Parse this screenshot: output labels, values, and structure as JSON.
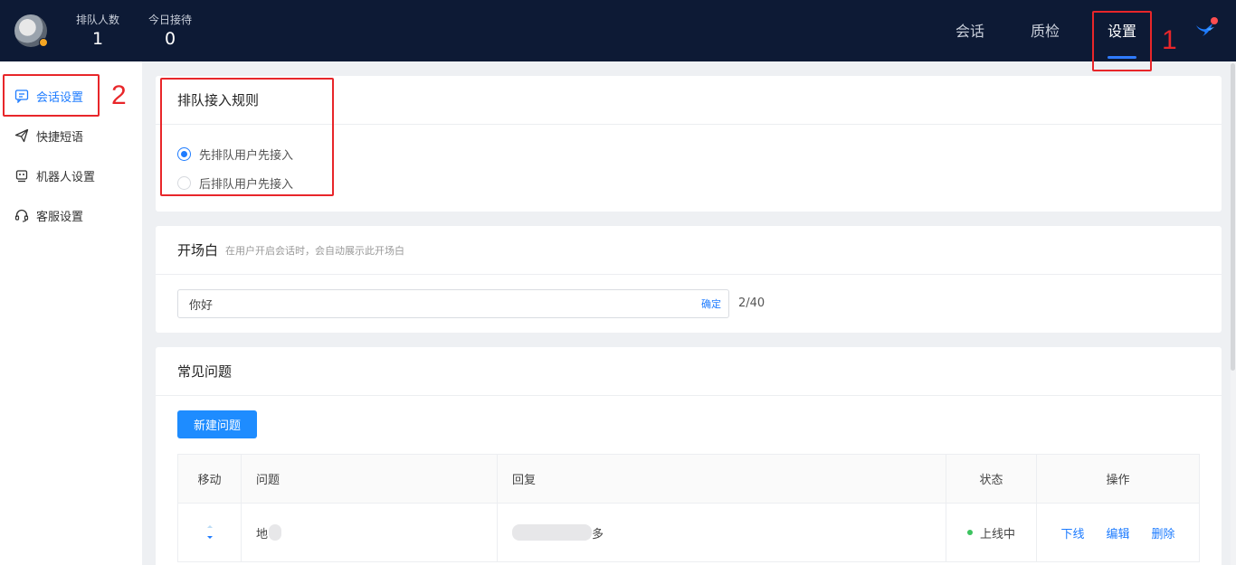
{
  "header": {
    "stats": [
      {
        "label": "排队人数",
        "value": "1"
      },
      {
        "label": "今日接待",
        "value": "0"
      }
    ],
    "nav": [
      {
        "label": "会话"
      },
      {
        "label": "质检"
      },
      {
        "label": "设置"
      }
    ],
    "active_nav": "设置"
  },
  "sidebar": {
    "items": [
      {
        "label": "会话设置",
        "icon": "chat-settings-icon"
      },
      {
        "label": "快捷短语",
        "icon": "send-icon"
      },
      {
        "label": "机器人设置",
        "icon": "robot-icon"
      },
      {
        "label": "客服设置",
        "icon": "headset-icon"
      }
    ]
  },
  "queue_rule": {
    "title": "排队接入规则",
    "options": [
      "先排队用户先接入",
      "后排队用户先接入"
    ],
    "selected_index": 0
  },
  "greeting": {
    "title": "开场白",
    "subtitle": "在用户开启会话时，会自动展示此开场白",
    "value": "你好",
    "confirm_label": "确定",
    "count": "2/40"
  },
  "faq": {
    "title": "常见问题",
    "new_button": "新建问题",
    "columns": [
      "移动",
      "问题",
      "回复",
      "状态",
      "操作"
    ],
    "rows": [
      {
        "question_visible": "地",
        "answer_visible": "多",
        "status": "上线中",
        "actions": [
          "下线",
          "编辑",
          "删除"
        ]
      }
    ]
  },
  "annotations": {
    "marker_1": "1",
    "marker_2": "2"
  },
  "colors": {
    "header_bg": "#0d1a35",
    "accent": "#1e7cff",
    "highlight": "#e8262a",
    "status_online": "#3cc35f"
  }
}
